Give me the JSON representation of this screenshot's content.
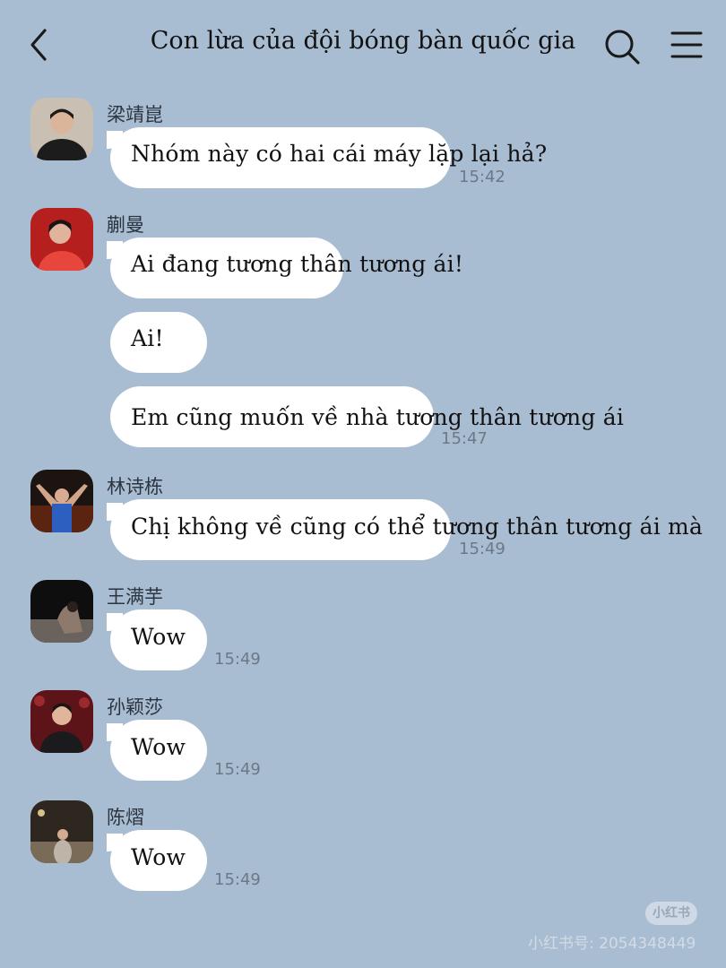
{
  "header": {
    "title": "Con lừa của đội bóng bàn quốc gia",
    "back_icon": "chevron-left-icon",
    "search_icon": "search-icon",
    "menu_icon": "menu-icon"
  },
  "messages": [
    {
      "sender": "梁靖崑",
      "text": "Nhóm này có hai cái máy lặp lại hả?",
      "time": "15:42"
    },
    {
      "sender": "蒯曼",
      "text": "Ai đang tương thân tương ái!"
    },
    {
      "text": "Ai!"
    },
    {
      "text": "Em cũng muốn về nhà tương thân tương ái",
      "time": "15:47"
    },
    {
      "sender": "林诗栋",
      "text": "Chị không về cũng có thể tương thân tương ái mà",
      "time": "15:49"
    },
    {
      "sender": "王满芋",
      "text": "Wow",
      "time": "15:49"
    },
    {
      "sender": "孙颖莎",
      "text": "Wow",
      "time": "15:49"
    },
    {
      "sender": "陈熠",
      "text": "Wow",
      "time": "15:49"
    }
  ],
  "watermark": {
    "badge": "小红书",
    "text": "小红书号: 2054348449"
  },
  "colors": {
    "background": "#a9bdd2",
    "bubble": "#ffffff",
    "time_text": "#6d7887"
  }
}
